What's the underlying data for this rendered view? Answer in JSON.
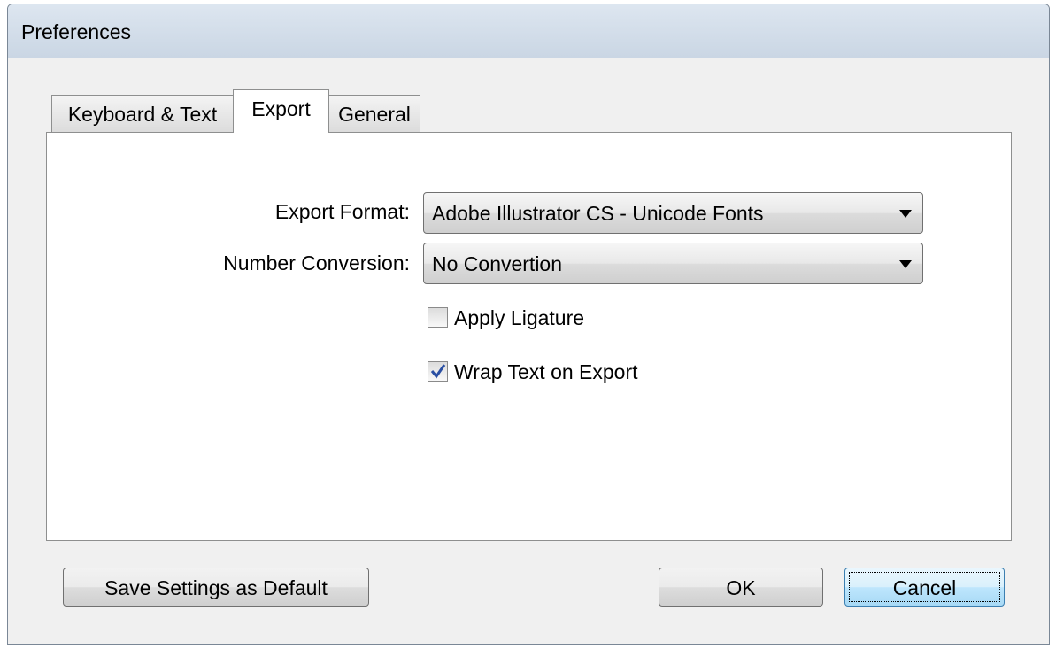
{
  "window": {
    "title": "Preferences"
  },
  "tabs": [
    {
      "label": "Keyboard & Text",
      "active": false
    },
    {
      "label": "Export",
      "active": true
    },
    {
      "label": "General",
      "active": false
    }
  ],
  "export": {
    "format_label": "Export Format:",
    "format_value": "Adobe Illustrator CS - Unicode Fonts",
    "number_label": "Number Conversion:",
    "number_value": "No Convertion",
    "ligature_label": "Apply Ligature",
    "ligature_checked": false,
    "wrap_label": "Wrap Text on Export",
    "wrap_checked": true
  },
  "buttons": {
    "save_default": "Save Settings as Default",
    "ok": "OK",
    "cancel": "Cancel"
  },
  "icons": {
    "dropdown": "chevron-down-icon",
    "check": "check-icon"
  },
  "colors": {
    "check_mark": "#2a4fa3",
    "focus_border": "#3c7fb1"
  }
}
